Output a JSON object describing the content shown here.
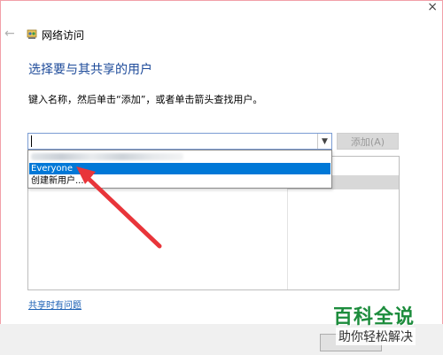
{
  "window": {
    "close_glyph": "×",
    "back_glyph": "←",
    "title": "网络访问"
  },
  "main": {
    "heading": "选择要与其共享的用户",
    "instruction": "键入名称，然后单击“添加”，或者单击箭头查找用户。",
    "combo_value": "",
    "add_button": "添加(A)",
    "dropdown_options": [
      "Everyone",
      "创建新用户..."
    ],
    "help_link": "共享时有问题"
  },
  "watermark": {
    "title": "百科全说",
    "subtitle": "助你轻松解决"
  },
  "colors": {
    "accent": "#0078d7",
    "annotation_arrow": "#e8353a",
    "heading": "#1e4b9a"
  },
  "icons": [
    "back-arrow-icon",
    "network-share-icon",
    "chevron-down-icon",
    "close-icon",
    "annotation-arrow-icon"
  ]
}
